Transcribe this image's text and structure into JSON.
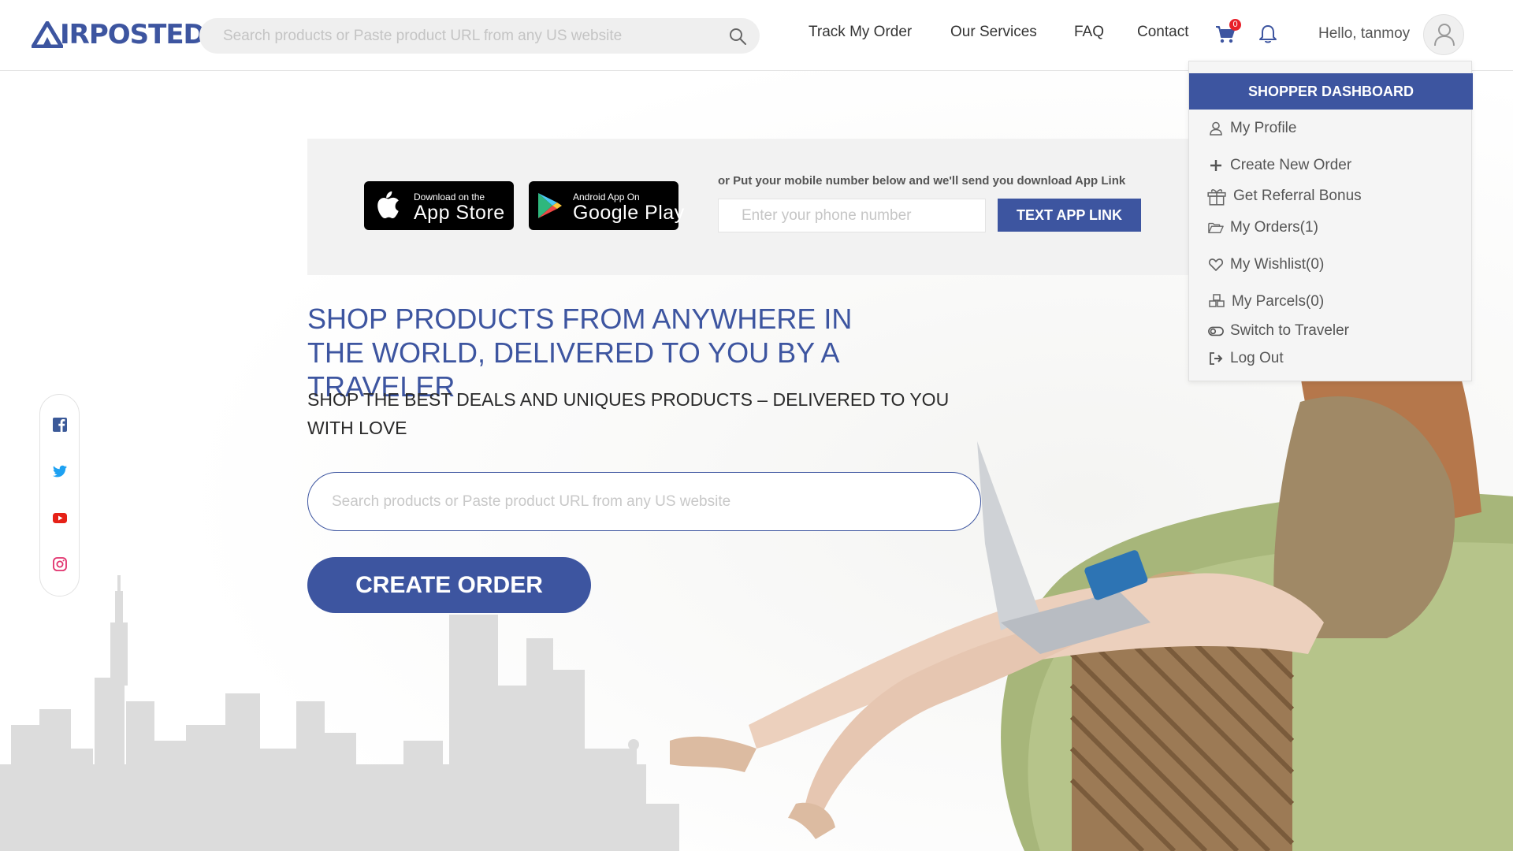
{
  "brand": {
    "name": "IRPOSTED",
    "color": "#3d55a0"
  },
  "header": {
    "search_placeholder": "Search products or Paste product URL from any US website",
    "nav": {
      "track": "Track My Order",
      "services": "Our Services",
      "faq": "FAQ",
      "contact": "Contact"
    },
    "cart_count": "0",
    "greeting": "Hello, tanmoy"
  },
  "app_banner": {
    "appstore_small": "Download on the",
    "appstore_big": "App Store",
    "googleplay_small": "Android App On",
    "googleplay_big": "Google Play",
    "prompt": "or Put your mobile number below and we'll send you download App Link",
    "phone_placeholder": "Enter your phone number",
    "button": "TEXT APP LINK"
  },
  "hero": {
    "title": "SHOP PRODUCTS FROM ANYWHERE IN THE WORLD, DELIVERED TO YOU BY A TRAVELER",
    "subtitle": "SHOP THE BEST DEALS AND UNIQUES PRODUCTS – DELIVERED TO YOU WITH LOVE",
    "search_placeholder": "Search products or Paste product URL from any US website",
    "button": "CREATE ORDER"
  },
  "social": [
    "facebook-icon",
    "twitter-icon",
    "youtube-icon",
    "instagram-icon"
  ],
  "dropdown": {
    "title": "SHOPPER DASHBOARD",
    "items": [
      {
        "label": "My Profile",
        "icon": "user-icon"
      },
      {
        "label": "Create New Order",
        "icon": "plus-icon"
      },
      {
        "label": "Get Referral Bonus",
        "icon": "gift-icon"
      },
      {
        "label": "My Orders(1)",
        "icon": "folder-open-icon"
      },
      {
        "label": "My Wishlist(0)",
        "icon": "heart-icon"
      },
      {
        "label": "My Parcels(0)",
        "icon": "parcels-icon"
      },
      {
        "label": "Switch to Traveler",
        "icon": "toggle-icon"
      },
      {
        "label": "Log Out",
        "icon": "logout-icon"
      }
    ]
  }
}
